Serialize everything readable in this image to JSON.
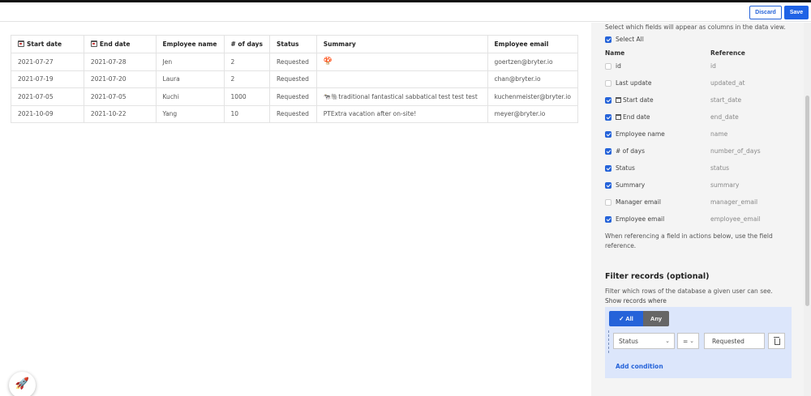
{
  "toolbar": {
    "discard_label": "Discard",
    "save_label": "Save"
  },
  "table": {
    "headers": [
      "Start date",
      "End date",
      "Employee name",
      "# of days",
      "Status",
      "Summary",
      "Employee email"
    ],
    "rows": [
      [
        "2021-07-27",
        "2021-07-28",
        "Jen",
        "2",
        "Requested",
        "🍄",
        "goertzen@bryter.io"
      ],
      [
        "2021-07-19",
        "2021-07-20",
        "Laura",
        "2",
        "Requested",
        "",
        "chan@bryter.io"
      ],
      [
        "2021-07-05",
        "2021-07-05",
        "Kuchi",
        "1000",
        "Requested",
        "🐄🐘traditional fantastical sabbatical test test test",
        "kuchenmeister@bryter.io"
      ],
      [
        "2021-10-09",
        "2021-10-22",
        "Yang",
        "10",
        "Requested",
        "PTExtra vacation after on-site!",
        "meyer@bryter.io"
      ]
    ]
  },
  "fields": {
    "intro": "Select which fields will appear as columns in the data view.",
    "select_all": "Select All",
    "col_name": "Name",
    "col_reference": "Reference",
    "items": [
      {
        "name": "id",
        "reference": "id",
        "checked": false,
        "cal": false
      },
      {
        "name": "Last update",
        "reference": "updated_at",
        "checked": false,
        "cal": false
      },
      {
        "name": "Start date",
        "reference": "start_date",
        "checked": true,
        "cal": true
      },
      {
        "name": "End date",
        "reference": "end_date",
        "checked": true,
        "cal": true
      },
      {
        "name": "Employee name",
        "reference": "name",
        "checked": true,
        "cal": false
      },
      {
        "name": "# of days",
        "reference": "number_of_days",
        "checked": true,
        "cal": false
      },
      {
        "name": "Status",
        "reference": "status",
        "checked": true,
        "cal": false
      },
      {
        "name": "Summary",
        "reference": "summary",
        "checked": true,
        "cal": false
      },
      {
        "name": "Manager email",
        "reference": "manager_email",
        "checked": false,
        "cal": false
      },
      {
        "name": "Employee email",
        "reference": "employee_email",
        "checked": true,
        "cal": false
      }
    ],
    "hint_line1": "When referencing a field in actions below, use the field",
    "hint_line2": "reference."
  },
  "filter": {
    "title": "Filter records (optional)",
    "description": "Filter which rows of the database a given user can see.",
    "show_where": "Show records where",
    "all_label": "All",
    "any_label": "Any",
    "field_value": "Status",
    "operator_value": "=",
    "compare_value": "Requested",
    "add_condition": "Add condition"
  },
  "colors": {
    "accent": "#2563d9",
    "panel_bg": "#f4f4f4",
    "filter_bg": "#dce6fb"
  },
  "icons": {
    "calendar": "calendar-icon",
    "rocket": "rocket-icon",
    "trash": "trash-icon",
    "check": "check-icon"
  }
}
